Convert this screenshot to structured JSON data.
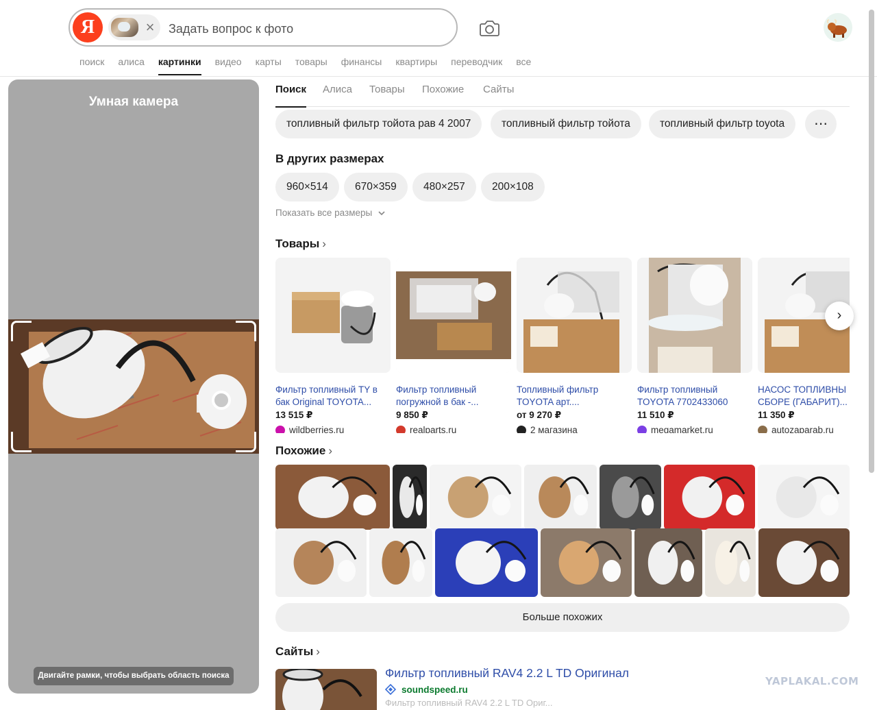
{
  "search": {
    "logo": "Я",
    "placeholder": "Задать вопрос к фото",
    "chip_close": "×"
  },
  "nav": [
    {
      "label": "поиск",
      "active": false
    },
    {
      "label": "алиса",
      "active": false
    },
    {
      "label": "картинки",
      "active": true
    },
    {
      "label": "видео",
      "active": false
    },
    {
      "label": "карты",
      "active": false
    },
    {
      "label": "товары",
      "active": false
    },
    {
      "label": "финансы",
      "active": false
    },
    {
      "label": "квартиры",
      "active": false
    },
    {
      "label": "переводчик",
      "active": false
    },
    {
      "label": "все",
      "active": false
    }
  ],
  "camera_panel": {
    "title": "Умная камера",
    "hint": "Двигайте рамки, чтобы выбрать область поиска"
  },
  "tabs": [
    {
      "label": "Поиск",
      "active": true
    },
    {
      "label": "Алиса",
      "active": false
    },
    {
      "label": "Товары",
      "active": false
    },
    {
      "label": "Похожие",
      "active": false
    },
    {
      "label": "Сайты",
      "active": false
    }
  ],
  "suggestions": [
    "топливный фильтр тойота рав 4 2007",
    "топливный фильтр тойота",
    "топливный фильтр toyota"
  ],
  "more_icon": "⋯",
  "sizes": {
    "title": "В других размерах",
    "items": [
      "960×514",
      "670×359",
      "480×257",
      "200×108"
    ],
    "show_all": "Показать все размеры"
  },
  "products": {
    "title": "Товары",
    "arrow": "›",
    "items": [
      {
        "title": "Фильтр топливный TY в бак Original TOYOTA...",
        "price": "13 515 ₽",
        "shop": "wildberries.ru",
        "shop_color": "#cb11ab"
      },
      {
        "title": "Фильтр топливный погружной в бак -...",
        "price": "9 850 ₽",
        "shop": "realparts.ru",
        "shop_color": "#d33a2c"
      },
      {
        "title": "Топливный фильтр TOYOTA арт....",
        "price": "от 9 270 ₽",
        "shop": "2 магазина",
        "shop_color": "#222222"
      },
      {
        "title": "Фильтр топливный TOYOTA 7702433060",
        "price": "11 510 ₽",
        "shop": "megamarket.ru",
        "shop_color": "#7b3fe4"
      },
      {
        "title": "НАСОС ТОПЛИВНЫ СБОРЕ (ГАБАРИТ)...",
        "price": "11 350 ₽",
        "shop": "autozaparab.ru",
        "shop_color": "#8a6d4a"
      }
    ],
    "next_icon": "›"
  },
  "similar": {
    "title": "Похожие",
    "arrow": "›",
    "more_button": "Больше похожих"
  },
  "sites": {
    "title": "Сайты",
    "arrow": "›",
    "first": {
      "title": "Фильтр топливный RAV4 2.2 L TD Оригинал",
      "domain": "soundspeed.ru",
      "snippet": "Фильтр топливный RAV4 2.2 L TD Ориг..."
    }
  },
  "watermark": "YAPLAKAL.COM"
}
